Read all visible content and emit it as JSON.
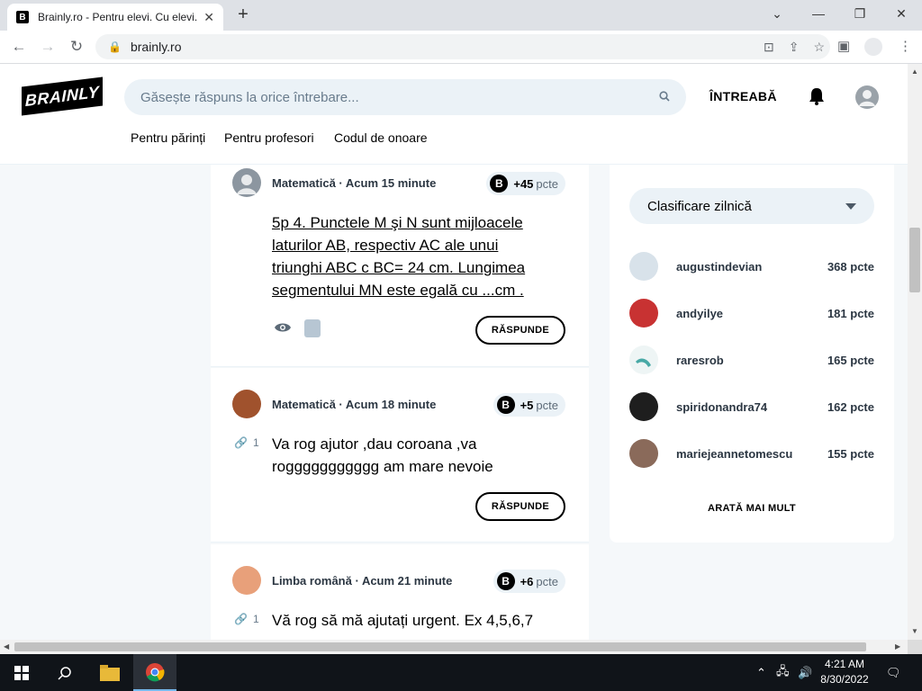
{
  "browser": {
    "tab_title": "Brainly.ro - Pentru elevi. Cu elevi.",
    "tab_favicon": "B",
    "url": "brainly.ro",
    "controls": {
      "minimize": "—",
      "maximize": "❐",
      "close": "✕",
      "tabs_dropdown": "⌄"
    }
  },
  "site": {
    "logo": "BRAINLY",
    "search_placeholder": "Găsește răspuns la orice întrebare...",
    "ask_label": "ÎNTREABĂ",
    "nav": [
      "Pentru părinți",
      "Pentru profesori",
      "Codul de onoare"
    ]
  },
  "feed": [
    {
      "subject": "Matematică",
      "time": "Acum 15 minute",
      "points": "+45",
      "points_unit": "pcte",
      "text": "5p 4. Punctele M şi N sunt mijloacele laturilor AB, respectiv AC ale unui triunghi ABC c BC= 24 cm. Lungimea segmentului MN este egală cu ...cm .",
      "answer_label": "RĂSPUNDE"
    },
    {
      "subject": "Matematică",
      "time": "Acum 18 minute",
      "points": "+5",
      "points_unit": "pcte",
      "attachments": "1",
      "text": "Va rog ajutor ,dau coroana ,va roggggggggggg am mare nevoie",
      "answer_label": "RĂSPUNDE"
    },
    {
      "subject": "Limba română",
      "time": "Acum 21 minute",
      "points": "+6",
      "points_unit": "pcte",
      "attachments": "1",
      "text": "Vă rog să mă ajutați urgent. Ex 4,5,6,7"
    }
  ],
  "ranking": {
    "selector_label": "Clasificare zilnică",
    "rows": [
      {
        "name": "augustindevian",
        "points": "368",
        "unit": "pcte"
      },
      {
        "name": "andyilye",
        "points": "181",
        "unit": "pcte"
      },
      {
        "name": "raresrob",
        "points": "165",
        "unit": "pcte"
      },
      {
        "name": "spiridonandra74",
        "points": "162",
        "unit": "pcte"
      },
      {
        "name": "mariejeannetomescu",
        "points": "155",
        "unit": "pcte"
      }
    ],
    "more_label": "ARATĂ MAI MULT"
  },
  "taskbar": {
    "time": "4:21 AM",
    "date": "8/30/2022"
  }
}
